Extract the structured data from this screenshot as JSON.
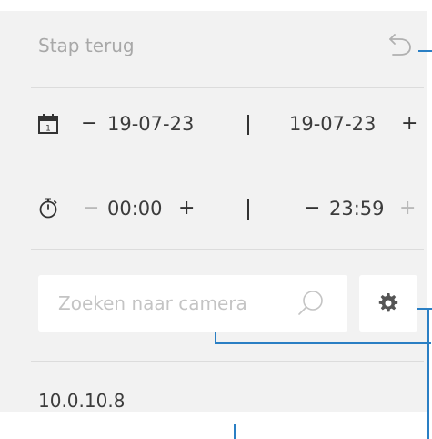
{
  "history": {
    "back_label": "Stap terug"
  },
  "date_range": {
    "decrement": "−",
    "start": "19-07-23",
    "separator": "|",
    "end": "19-07-23",
    "increment": "+"
  },
  "time_range": {
    "start_decrement": "−",
    "start": "00:00",
    "start_increment": "+",
    "separator": "|",
    "end_decrement": "−",
    "end": "23:59",
    "end_increment": "+"
  },
  "search": {
    "placeholder": "Zoeken naar camera"
  },
  "camera_list": {
    "items": [
      {
        "label": "10.0.10.8"
      }
    ]
  },
  "colors": {
    "panel_bg": "#f2f2f2",
    "divider": "#dcdcdc",
    "accent_connector": "#2a7fc4",
    "muted_text": "#a8a8a8"
  },
  "icons": {
    "undo": "undo-icon",
    "calendar": "calendar-icon",
    "timer": "stopwatch-icon",
    "search": "search-icon",
    "settings": "gear-icon"
  }
}
